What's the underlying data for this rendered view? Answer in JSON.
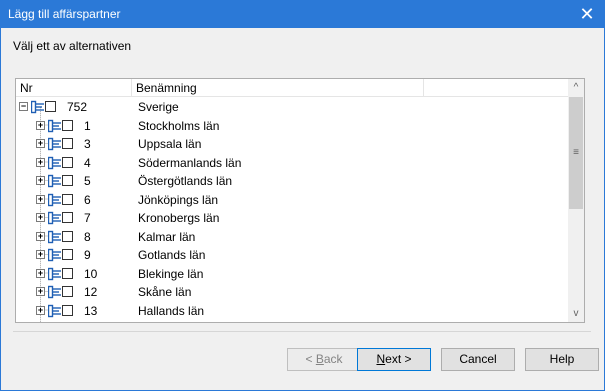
{
  "window": {
    "title": "Lägg till affärspartner",
    "close_glyph": "✕"
  },
  "instruction": "Välj ett av alternativen",
  "tree": {
    "columns": [
      "Nr",
      "Benämning",
      ""
    ],
    "root": {
      "nr": "752",
      "name": "Sverige",
      "expander": "−"
    },
    "children": [
      {
        "nr": "1",
        "name": "Stockholms län",
        "expander": "+"
      },
      {
        "nr": "3",
        "name": "Uppsala län",
        "expander": "+"
      },
      {
        "nr": "4",
        "name": "Södermanlands län",
        "expander": "+"
      },
      {
        "nr": "5",
        "name": "Östergötlands län",
        "expander": "+"
      },
      {
        "nr": "6",
        "name": "Jönköpings län",
        "expander": "+"
      },
      {
        "nr": "7",
        "name": "Kronobergs län",
        "expander": "+"
      },
      {
        "nr": "8",
        "name": "Kalmar län",
        "expander": "+"
      },
      {
        "nr": "9",
        "name": "Gotlands län",
        "expander": "+"
      },
      {
        "nr": "10",
        "name": "Blekinge län",
        "expander": "+"
      },
      {
        "nr": "12",
        "name": "Skåne län",
        "expander": "+"
      },
      {
        "nr": "13",
        "name": "Hallands län",
        "expander": "+"
      }
    ],
    "icon": "tree-node-icon",
    "scroll_up": "^",
    "scroll_down": "v",
    "scroll_grip": "≡"
  },
  "buttons": {
    "back_u": "B",
    "back_rest": "ack",
    "back_prefix": "< ",
    "next_u": "N",
    "next_rest": "ext >",
    "cancel": "Cancel",
    "help": "Help"
  },
  "colors": {
    "titlebar": "#2b79d7",
    "accent": "#0078d7",
    "icon_blue": "#1f5fb4"
  }
}
